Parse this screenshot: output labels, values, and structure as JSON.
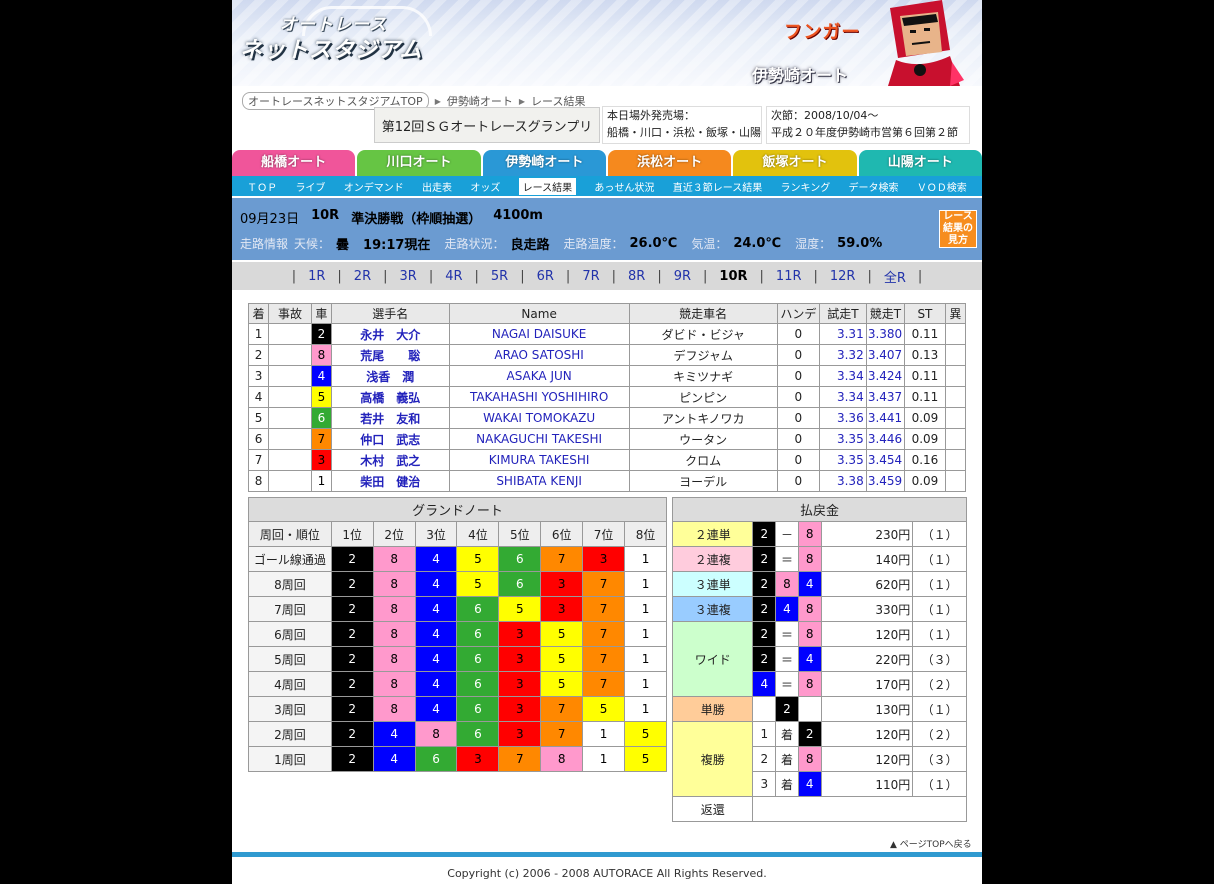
{
  "header": {
    "logo_line1": "オートレース",
    "logo_line2": "ネットスタジアム",
    "character": "フンガー",
    "venue": "伊勢崎オート"
  },
  "breadcrumb": [
    "オートレースネットスタジアムTOP",
    "伊勢崎オート",
    "レース結果"
  ],
  "race_title": "第12回ＳＧオートレースグランプリ",
  "sales": {
    "label": "本日場外発売場：",
    "list": "船橋・川口・浜松・飯塚・山陽"
  },
  "next": {
    "label": "次節：2008/10/04～",
    "desc": "平成２０年度伊勢崎市営第６回第２節"
  },
  "venue_tabs": [
    {
      "label": "船橋オート",
      "color": "#f0559a"
    },
    {
      "label": "川口オート",
      "color": "#66c544"
    },
    {
      "label": "伊勢崎オート",
      "color": "#2a98d6"
    },
    {
      "label": "浜松オート",
      "color": "#f5891e"
    },
    {
      "label": "飯塚オート",
      "color": "#e2c20d"
    },
    {
      "label": "山陽オート",
      "color": "#1fb8b0"
    }
  ],
  "subnav": [
    "ＴＯＰ",
    "ライブ",
    "オンデマンド",
    "出走表",
    "オッズ",
    "レース結果",
    "あっせん状況",
    "直近３節レース結果",
    "ランキング",
    "データ検索",
    "ＶＯＤ検索"
  ],
  "subnav_active": "レース結果",
  "race_info": {
    "date": "09月23日",
    "race": "10R",
    "name": "準決勝戦（枠順抽選）",
    "distance": "4100m",
    "conditions": [
      {
        "k": "走路情報",
        "v": ""
      },
      {
        "k": "天候：",
        "v": "曇"
      },
      {
        "k": "",
        "v": "19:17現在"
      },
      {
        "k": "走路状況：",
        "v": "良走路"
      },
      {
        "k": "走路温度：",
        "v": "26.0℃"
      },
      {
        "k": "気温：",
        "v": "24.0℃"
      },
      {
        "k": "湿度：",
        "v": "59.0%"
      }
    ],
    "guide": "レース結果の見方"
  },
  "race_nav": [
    "1R",
    "2R",
    "3R",
    "4R",
    "5R",
    "6R",
    "7R",
    "8R",
    "9R",
    "10R",
    "11R",
    "12R",
    "全R"
  ],
  "race_nav_current": "10R",
  "results_headers": [
    "着",
    "事故",
    "車",
    "選手名",
    "Name",
    "競走車名",
    "ハンデ",
    "試走T",
    "競走T",
    "ST",
    "異"
  ],
  "results": [
    {
      "pos": "1",
      "acc": "",
      "car": "2",
      "jp": "永井　大介",
      "en": "NAGAI DAISUKE",
      "bike": "ダビド・ビジャ",
      "handi": "0",
      "trial": "3.31",
      "race": "3.380",
      "st": "0.11",
      "x": ""
    },
    {
      "pos": "2",
      "acc": "",
      "car": "8",
      "jp": "荒尾　　聡",
      "en": "ARAO SATOSHI",
      "bike": "デフジャム",
      "handi": "0",
      "trial": "3.32",
      "race": "3.407",
      "st": "0.13",
      "x": ""
    },
    {
      "pos": "3",
      "acc": "",
      "car": "4",
      "jp": "浅香　潤",
      "en": "ASAKA JUN",
      "bike": "キミツナギ",
      "handi": "0",
      "trial": "3.34",
      "race": "3.424",
      "st": "0.11",
      "x": ""
    },
    {
      "pos": "4",
      "acc": "",
      "car": "5",
      "jp": "高橋　義弘",
      "en": "TAKAHASHI YOSHIHIRO",
      "bike": "ピンピン",
      "handi": "0",
      "trial": "3.34",
      "race": "3.437",
      "st": "0.11",
      "x": ""
    },
    {
      "pos": "5",
      "acc": "",
      "car": "6",
      "jp": "若井　友和",
      "en": "WAKAI TOMOKAZU",
      "bike": "アントキノワカ",
      "handi": "0",
      "trial": "3.36",
      "race": "3.441",
      "st": "0.09",
      "x": ""
    },
    {
      "pos": "6",
      "acc": "",
      "car": "7",
      "jp": "仲口　武志",
      "en": "NAKAGUCHI TAKESHI",
      "bike": "ウータン",
      "handi": "0",
      "trial": "3.35",
      "race": "3.446",
      "st": "0.09",
      "x": ""
    },
    {
      "pos": "7",
      "acc": "",
      "car": "3",
      "jp": "木村　武之",
      "en": "KIMURA TAKESHI",
      "bike": "クロム",
      "handi": "0",
      "trial": "3.35",
      "race": "3.454",
      "st": "0.16",
      "x": ""
    },
    {
      "pos": "8",
      "acc": "",
      "car": "1",
      "jp": "柴田　健治",
      "en": "SHIBATA KENJI",
      "bike": "ヨーデル",
      "handi": "0",
      "trial": "3.38",
      "race": "3.459",
      "st": "0.09",
      "x": ""
    }
  ],
  "grand_note": {
    "title": "グランドノート",
    "headers": [
      "周回・順位",
      "1位",
      "2位",
      "3位",
      "4位",
      "5位",
      "6位",
      "7位",
      "8位"
    ],
    "rows": [
      {
        "label": "ゴール線通過",
        "cars": [
          "2",
          "8",
          "4",
          "5",
          "6",
          "7",
          "3",
          "1"
        ]
      },
      {
        "label": "8周回",
        "cars": [
          "2",
          "8",
          "4",
          "5",
          "6",
          "3",
          "7",
          "1"
        ]
      },
      {
        "label": "7周回",
        "cars": [
          "2",
          "8",
          "4",
          "6",
          "5",
          "3",
          "7",
          "1"
        ]
      },
      {
        "label": "6周回",
        "cars": [
          "2",
          "8",
          "4",
          "6",
          "3",
          "5",
          "7",
          "1"
        ]
      },
      {
        "label": "5周回",
        "cars": [
          "2",
          "8",
          "4",
          "6",
          "3",
          "5",
          "7",
          "1"
        ]
      },
      {
        "label": "4周回",
        "cars": [
          "2",
          "8",
          "4",
          "6",
          "3",
          "5",
          "7",
          "1"
        ]
      },
      {
        "label": "3周回",
        "cars": [
          "2",
          "8",
          "4",
          "6",
          "3",
          "7",
          "5",
          "1"
        ]
      },
      {
        "label": "2周回",
        "cars": [
          "2",
          "4",
          "8",
          "6",
          "3",
          "7",
          "1",
          "5"
        ]
      },
      {
        "label": "1周回",
        "cars": [
          "2",
          "4",
          "6",
          "3",
          "7",
          "8",
          "1",
          "5"
        ]
      }
    ]
  },
  "payout": {
    "title": "払戻金",
    "rows": [
      {
        "type": "２連単",
        "cls": "k1",
        "a": "2",
        "op": "－",
        "b": "8",
        "c": "",
        "amount": "230円",
        "pop": "（１）",
        "span": 1
      },
      {
        "type": "２連複",
        "cls": "k2",
        "a": "2",
        "op": "＝",
        "b": "8",
        "c": "",
        "amount": "140円",
        "pop": "（１）",
        "span": 1
      },
      {
        "type": "３連単",
        "cls": "k3",
        "a": "2",
        "op": "",
        "b": "8",
        "c": "4",
        "amount": "620円",
        "pop": "（１）",
        "span": 1
      },
      {
        "type": "３連複",
        "cls": "k4",
        "a": "2",
        "op": "",
        "b": "4",
        "c": "8",
        "amount": "330円",
        "pop": "（１）",
        "span": 1
      },
      {
        "type": "ワイド",
        "cls": "k5",
        "a": "2",
        "op": "＝",
        "b": "8",
        "c": "",
        "amount": "120円",
        "pop": "（１）",
        "span": 3
      },
      {
        "type": "",
        "cls": "k5",
        "a": "2",
        "op": "＝",
        "b": "4",
        "c": "",
        "amount": "220円",
        "pop": "（３）",
        "span": 0
      },
      {
        "type": "",
        "cls": "k5",
        "a": "4",
        "op": "＝",
        "b": "8",
        "c": "",
        "amount": "170円",
        "pop": "（２）",
        "span": 0
      },
      {
        "type": "単勝",
        "cls": "k6",
        "a": "",
        "op": "2",
        "b": "",
        "c": "",
        "amount": "130円",
        "pop": "（１）",
        "span": 1
      },
      {
        "type": "複勝",
        "cls": "k7",
        "a": "1",
        "op": "着",
        "b": "2",
        "c": "",
        "amount": "120円",
        "pop": "（２）",
        "span": 3
      },
      {
        "type": "",
        "cls": "k7",
        "a": "2",
        "op": "着",
        "b": "8",
        "c": "",
        "amount": "120円",
        "pop": "（３）",
        "span": 0
      },
      {
        "type": "",
        "cls": "k7",
        "a": "3",
        "op": "着",
        "b": "4",
        "c": "",
        "amount": "110円",
        "pop": "（１）",
        "span": 0
      },
      {
        "type": "返還",
        "cls": "",
        "a": "",
        "op": "",
        "b": "",
        "c": "",
        "amount": "",
        "pop": "",
        "span": 1
      }
    ]
  },
  "page_top": "ページTOPへ戻る",
  "footer": "Copyright (c) 2006 - 2008 AUTORACE All Rights Reserved."
}
